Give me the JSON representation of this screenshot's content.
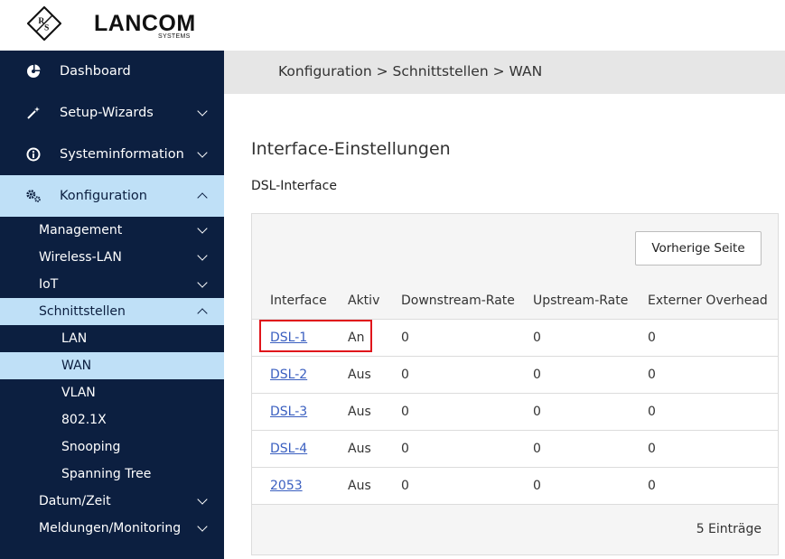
{
  "brand": {
    "name": "LANCOM",
    "sub": "SYSTEMS",
    "mark": "R&S"
  },
  "nav": {
    "dashboard": "Dashboard",
    "setup_wizards": "Setup-Wizards",
    "systeminfo": "Systeminformation",
    "konfiguration": "Konfiguration",
    "sub": {
      "management": "Management",
      "wlan": "Wireless-LAN",
      "iot": "IoT",
      "schnittstellen": "Schnittstellen",
      "lan": "LAN",
      "wan": "WAN",
      "vlan": "VLAN",
      "dot1x": "802.1X",
      "snooping": "Snooping",
      "spanning_tree": "Spanning Tree",
      "datum": "Datum/Zeit",
      "meldungen": "Meldungen/Monitoring"
    }
  },
  "breadcrumb": "Konfiguration > Schnittstellen > WAN",
  "main": {
    "title": "Interface-Einstellungen",
    "section": "DSL-Interface",
    "prev_button": "Vorherige Seite",
    "count": "5 Einträge",
    "columns": [
      "Interface",
      "Aktiv",
      "Downstream-Rate",
      "Upstream-Rate",
      "Externer Overhead"
    ],
    "rows": [
      [
        "DSL-1",
        "An",
        "0",
        "0",
        "0"
      ],
      [
        "DSL-2",
        "Aus",
        "0",
        "0",
        "0"
      ],
      [
        "DSL-3",
        "Aus",
        "0",
        "0",
        "0"
      ],
      [
        "DSL-4",
        "Aus",
        "0",
        "0",
        "0"
      ],
      [
        "2053",
        "Aus",
        "0",
        "0",
        "0"
      ]
    ]
  },
  "colors": {
    "sidebar": "#0c1f40",
    "active": "#bfe0f7",
    "link": "#3a5fc0",
    "highlight": "#e0151b"
  }
}
